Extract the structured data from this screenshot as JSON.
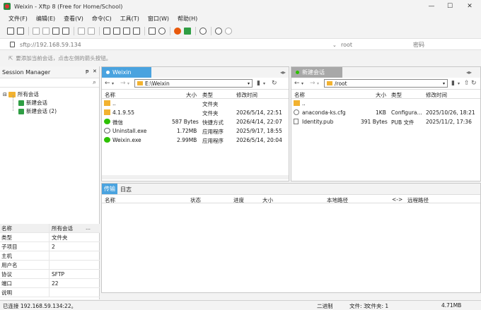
{
  "window": {
    "title": "Weixin - Xftp 8 (Free for Home/School)",
    "minimize": "—",
    "maximize": "☐",
    "close": "✕"
  },
  "menu": [
    "文件(F)",
    "编辑(E)",
    "查看(V)",
    "命令(C)",
    "工具(T)",
    "窗口(W)",
    "帮助(H)"
  ],
  "address": {
    "host_placeholder": "sftp://192.168.59.134",
    "user_placeholder": "root",
    "password_placeholder": "密码"
  },
  "hint": "要添加当前会话，点击左侧的箭头按钮。",
  "session_manager": {
    "title": "Session Manager",
    "pin": "ᵽ",
    "close": "✕",
    "search_glyph": "⌕",
    "tree": {
      "root": "所有会话",
      "children": [
        "新建会话",
        "新建会话 (2)"
      ]
    },
    "properties_header": [
      "名称",
      "所有会话"
    ],
    "properties": [
      {
        "k": "类型",
        "v": "文件夹"
      },
      {
        "k": "子项目",
        "v": "2"
      },
      {
        "k": "主机",
        "v": ""
      },
      {
        "k": "用户名",
        "v": ""
      },
      {
        "k": "协议",
        "v": "SFTP"
      },
      {
        "k": "端口",
        "v": "22"
      },
      {
        "k": "说明",
        "v": ""
      }
    ]
  },
  "left_pane": {
    "tab": "Weixin",
    "tab_color": "#4aa3df",
    "path": "E:\\Weixin",
    "columns": [
      "名称",
      "大小",
      "类型",
      "修改时间"
    ],
    "rows": [
      {
        "name": "..",
        "size": "",
        "type": "文件夹",
        "mtime": "",
        "icon": "folder-icon"
      },
      {
        "name": "4.1.9.55",
        "size": "",
        "type": "文件夹",
        "mtime": "2026/5/14, 22:51",
        "icon": "folder-icon"
      },
      {
        "name": "微信",
        "size": "587 Bytes",
        "type": "快捷方式",
        "mtime": "2026/4/14, 22:07",
        "icon": "wechat-icon"
      },
      {
        "name": "Uninstall.exe",
        "size": "1.72MB",
        "type": "应用程序",
        "mtime": "2025/9/17, 18:55",
        "icon": "uninstall-icon"
      },
      {
        "name": "Weixin.exe",
        "size": "2.99MB",
        "type": "应用程序",
        "mtime": "2026/5/14, 20:04",
        "icon": "wechat-icon"
      }
    ]
  },
  "right_pane": {
    "tab": "新建会话",
    "tab_color": "#9a9a9a",
    "path": "/root",
    "columns": [
      "名称",
      "大小",
      "类型",
      "修改时间"
    ],
    "rows": [
      {
        "name": "..",
        "size": "",
        "type": "",
        "mtime": "",
        "icon": "folder-icon"
      },
      {
        "name": "anaconda-ks.cfg",
        "size": "1KB",
        "type": "Configura...",
        "mtime": "2025/10/26, 18:21",
        "icon": "config-file-icon"
      },
      {
        "name": "Identity.pub",
        "size": "391 Bytes",
        "type": "PUB 文件",
        "mtime": "2025/11/2, 17:36",
        "icon": "file-icon"
      }
    ]
  },
  "transfer": {
    "tabs": [
      "传输",
      "日志"
    ],
    "columns": [
      "名称",
      "状态",
      "进度",
      "大小",
      "本地路径",
      "<->",
      "远程路径"
    ]
  },
  "status": {
    "connection": "已连接 192.168.59.134:22。",
    "mode": "二进制",
    "files": "文件: 3",
    "folders": "文件夹: 1",
    "size": "4.71MB"
  },
  "colors": {
    "accent": "#4aa3df",
    "folder": "#f2b230",
    "session": "#2f9e44",
    "wechat": "#2dc100"
  }
}
